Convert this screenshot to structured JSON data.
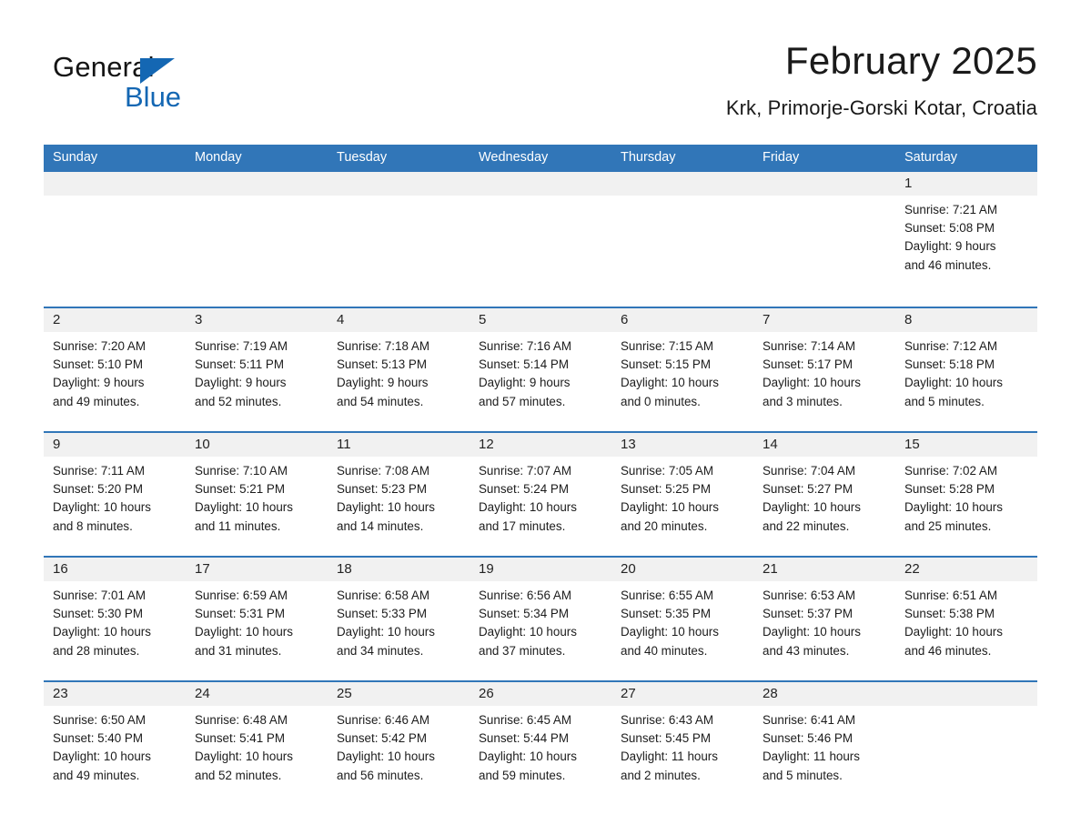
{
  "brand": {
    "name_part1": "General",
    "name_part2": "Blue",
    "accent_color": "#1467b3",
    "triangle_icon": "triangle-icon"
  },
  "header": {
    "title": "February 2025",
    "subtitle": "Krk, Primorje-Gorski Kotar, Croatia"
  },
  "calendar": {
    "header_bg": "#3176b8",
    "daynumber_bg": "#f1f1f1",
    "weekdays": [
      "Sunday",
      "Monday",
      "Tuesday",
      "Wednesday",
      "Thursday",
      "Friday",
      "Saturday"
    ],
    "weeks": [
      {
        "days": [
          {
            "num": "",
            "sunrise": "",
            "sunset": "",
            "daylight1": "",
            "daylight2": ""
          },
          {
            "num": "",
            "sunrise": "",
            "sunset": "",
            "daylight1": "",
            "daylight2": ""
          },
          {
            "num": "",
            "sunrise": "",
            "sunset": "",
            "daylight1": "",
            "daylight2": ""
          },
          {
            "num": "",
            "sunrise": "",
            "sunset": "",
            "daylight1": "",
            "daylight2": ""
          },
          {
            "num": "",
            "sunrise": "",
            "sunset": "",
            "daylight1": "",
            "daylight2": ""
          },
          {
            "num": "",
            "sunrise": "",
            "sunset": "",
            "daylight1": "",
            "daylight2": ""
          },
          {
            "num": "1",
            "sunrise": "Sunrise: 7:21 AM",
            "sunset": "Sunset: 5:08 PM",
            "daylight1": "Daylight: 9 hours",
            "daylight2": "and 46 minutes."
          }
        ]
      },
      {
        "days": [
          {
            "num": "2",
            "sunrise": "Sunrise: 7:20 AM",
            "sunset": "Sunset: 5:10 PM",
            "daylight1": "Daylight: 9 hours",
            "daylight2": "and 49 minutes."
          },
          {
            "num": "3",
            "sunrise": "Sunrise: 7:19 AM",
            "sunset": "Sunset: 5:11 PM",
            "daylight1": "Daylight: 9 hours",
            "daylight2": "and 52 minutes."
          },
          {
            "num": "4",
            "sunrise": "Sunrise: 7:18 AM",
            "sunset": "Sunset: 5:13 PM",
            "daylight1": "Daylight: 9 hours",
            "daylight2": "and 54 minutes."
          },
          {
            "num": "5",
            "sunrise": "Sunrise: 7:16 AM",
            "sunset": "Sunset: 5:14 PM",
            "daylight1": "Daylight: 9 hours",
            "daylight2": "and 57 minutes."
          },
          {
            "num": "6",
            "sunrise": "Sunrise: 7:15 AM",
            "sunset": "Sunset: 5:15 PM",
            "daylight1": "Daylight: 10 hours",
            "daylight2": "and 0 minutes."
          },
          {
            "num": "7",
            "sunrise": "Sunrise: 7:14 AM",
            "sunset": "Sunset: 5:17 PM",
            "daylight1": "Daylight: 10 hours",
            "daylight2": "and 3 minutes."
          },
          {
            "num": "8",
            "sunrise": "Sunrise: 7:12 AM",
            "sunset": "Sunset: 5:18 PM",
            "daylight1": "Daylight: 10 hours",
            "daylight2": "and 5 minutes."
          }
        ]
      },
      {
        "days": [
          {
            "num": "9",
            "sunrise": "Sunrise: 7:11 AM",
            "sunset": "Sunset: 5:20 PM",
            "daylight1": "Daylight: 10 hours",
            "daylight2": "and 8 minutes."
          },
          {
            "num": "10",
            "sunrise": "Sunrise: 7:10 AM",
            "sunset": "Sunset: 5:21 PM",
            "daylight1": "Daylight: 10 hours",
            "daylight2": "and 11 minutes."
          },
          {
            "num": "11",
            "sunrise": "Sunrise: 7:08 AM",
            "sunset": "Sunset: 5:23 PM",
            "daylight1": "Daylight: 10 hours",
            "daylight2": "and 14 minutes."
          },
          {
            "num": "12",
            "sunrise": "Sunrise: 7:07 AM",
            "sunset": "Sunset: 5:24 PM",
            "daylight1": "Daylight: 10 hours",
            "daylight2": "and 17 minutes."
          },
          {
            "num": "13",
            "sunrise": "Sunrise: 7:05 AM",
            "sunset": "Sunset: 5:25 PM",
            "daylight1": "Daylight: 10 hours",
            "daylight2": "and 20 minutes."
          },
          {
            "num": "14",
            "sunrise": "Sunrise: 7:04 AM",
            "sunset": "Sunset: 5:27 PM",
            "daylight1": "Daylight: 10 hours",
            "daylight2": "and 22 minutes."
          },
          {
            "num": "15",
            "sunrise": "Sunrise: 7:02 AM",
            "sunset": "Sunset: 5:28 PM",
            "daylight1": "Daylight: 10 hours",
            "daylight2": "and 25 minutes."
          }
        ]
      },
      {
        "days": [
          {
            "num": "16",
            "sunrise": "Sunrise: 7:01 AM",
            "sunset": "Sunset: 5:30 PM",
            "daylight1": "Daylight: 10 hours",
            "daylight2": "and 28 minutes."
          },
          {
            "num": "17",
            "sunrise": "Sunrise: 6:59 AM",
            "sunset": "Sunset: 5:31 PM",
            "daylight1": "Daylight: 10 hours",
            "daylight2": "and 31 minutes."
          },
          {
            "num": "18",
            "sunrise": "Sunrise: 6:58 AM",
            "sunset": "Sunset: 5:33 PM",
            "daylight1": "Daylight: 10 hours",
            "daylight2": "and 34 minutes."
          },
          {
            "num": "19",
            "sunrise": "Sunrise: 6:56 AM",
            "sunset": "Sunset: 5:34 PM",
            "daylight1": "Daylight: 10 hours",
            "daylight2": "and 37 minutes."
          },
          {
            "num": "20",
            "sunrise": "Sunrise: 6:55 AM",
            "sunset": "Sunset: 5:35 PM",
            "daylight1": "Daylight: 10 hours",
            "daylight2": "and 40 minutes."
          },
          {
            "num": "21",
            "sunrise": "Sunrise: 6:53 AM",
            "sunset": "Sunset: 5:37 PM",
            "daylight1": "Daylight: 10 hours",
            "daylight2": "and 43 minutes."
          },
          {
            "num": "22",
            "sunrise": "Sunrise: 6:51 AM",
            "sunset": "Sunset: 5:38 PM",
            "daylight1": "Daylight: 10 hours",
            "daylight2": "and 46 minutes."
          }
        ]
      },
      {
        "days": [
          {
            "num": "23",
            "sunrise": "Sunrise: 6:50 AM",
            "sunset": "Sunset: 5:40 PM",
            "daylight1": "Daylight: 10 hours",
            "daylight2": "and 49 minutes."
          },
          {
            "num": "24",
            "sunrise": "Sunrise: 6:48 AM",
            "sunset": "Sunset: 5:41 PM",
            "daylight1": "Daylight: 10 hours",
            "daylight2": "and 52 minutes."
          },
          {
            "num": "25",
            "sunrise": "Sunrise: 6:46 AM",
            "sunset": "Sunset: 5:42 PM",
            "daylight1": "Daylight: 10 hours",
            "daylight2": "and 56 minutes."
          },
          {
            "num": "26",
            "sunrise": "Sunrise: 6:45 AM",
            "sunset": "Sunset: 5:44 PM",
            "daylight1": "Daylight: 10 hours",
            "daylight2": "and 59 minutes."
          },
          {
            "num": "27",
            "sunrise": "Sunrise: 6:43 AM",
            "sunset": "Sunset: 5:45 PM",
            "daylight1": "Daylight: 11 hours",
            "daylight2": "and 2 minutes."
          },
          {
            "num": "28",
            "sunrise": "Sunrise: 6:41 AM",
            "sunset": "Sunset: 5:46 PM",
            "daylight1": "Daylight: 11 hours",
            "daylight2": "and 5 minutes."
          },
          {
            "num": "",
            "sunrise": "",
            "sunset": "",
            "daylight1": "",
            "daylight2": ""
          }
        ]
      }
    ]
  }
}
